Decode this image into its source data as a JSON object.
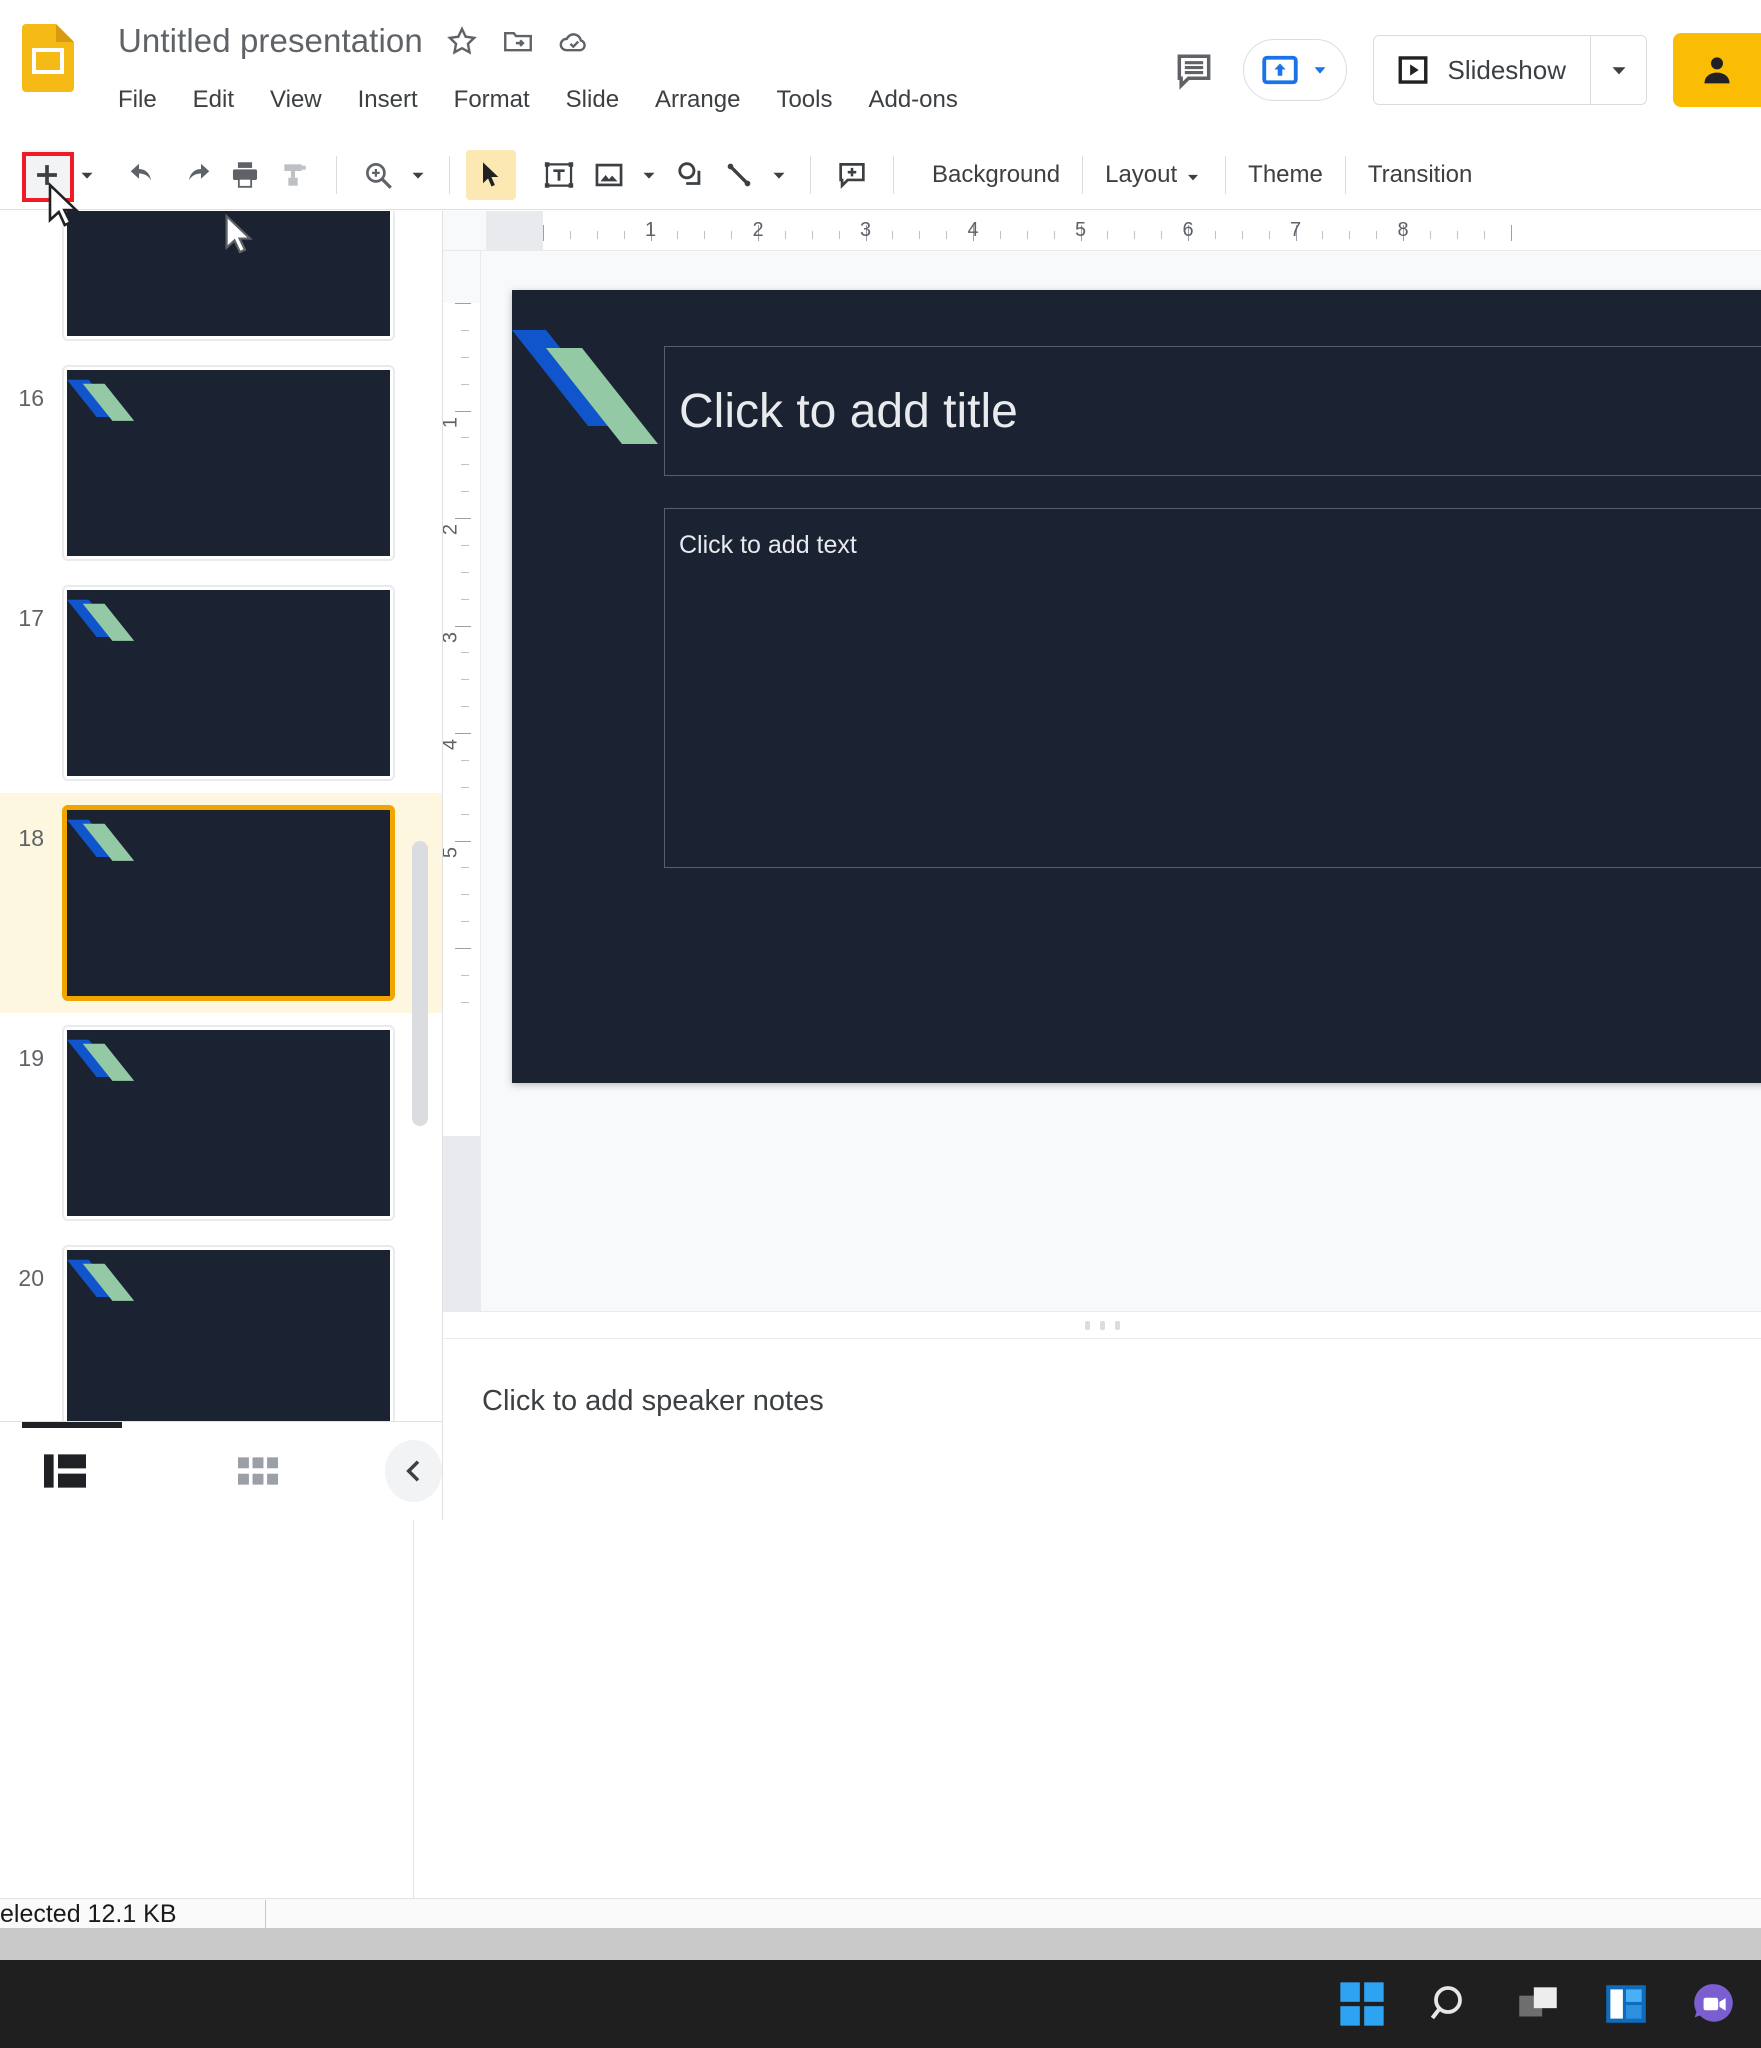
{
  "app": {
    "name": "Google Slides",
    "doc_title": "Untitled presentation"
  },
  "header": {
    "icons": [
      "star-icon",
      "move-to-folder-icon",
      "cloud-saved-icon"
    ],
    "menu_items": [
      "File",
      "Edit",
      "View",
      "Insert",
      "Format",
      "Slide",
      "Arrange",
      "Tools",
      "Add-ons"
    ],
    "comment_icon": "comment-history-icon",
    "present_icon": "present-to-meeting-icon",
    "slideshow_label": "Slideshow",
    "share_icon": "share-person-icon"
  },
  "toolbar": {
    "items": [
      {
        "name": "new-slide-button",
        "icon": "plus-icon",
        "highlighted": true
      },
      {
        "name": "new-slide-dropdown",
        "icon": "chevron-down-icon"
      },
      {
        "name": "undo-button",
        "icon": "undo-icon"
      },
      {
        "name": "redo-button",
        "icon": "redo-icon"
      },
      {
        "name": "print-button",
        "icon": "print-icon"
      },
      {
        "name": "paint-format-button",
        "icon": "paint-roller-icon"
      },
      {
        "name": "zoom-button",
        "icon": "zoom-in-icon"
      },
      {
        "name": "zoom-dropdown",
        "icon": "chevron-down-icon"
      },
      {
        "name": "select-tool",
        "icon": "cursor-arrow-icon",
        "selected": true
      },
      {
        "name": "textbox-tool",
        "icon": "text-box-icon"
      },
      {
        "name": "image-tool",
        "icon": "image-icon"
      },
      {
        "name": "image-dropdown",
        "icon": "chevron-down-icon"
      },
      {
        "name": "shape-tool",
        "icon": "shape-icon"
      },
      {
        "name": "line-tool",
        "icon": "line-icon"
      },
      {
        "name": "line-dropdown",
        "icon": "chevron-down-icon"
      },
      {
        "name": "add-comment-button",
        "icon": "add-comment-icon"
      }
    ],
    "background_label": "Background",
    "layout_label": "Layout",
    "theme_label": "Theme",
    "transition_label": "Transition",
    "highlight_color": "#ee1c25",
    "selected_color": "#fce8b2"
  },
  "filmstrip": {
    "slides": [
      {
        "number": "",
        "selected": false,
        "partial": true
      },
      {
        "number": "16",
        "selected": false
      },
      {
        "number": "17",
        "selected": false
      },
      {
        "number": "18",
        "selected": true
      },
      {
        "number": "19",
        "selected": false
      },
      {
        "number": "20",
        "selected": false
      }
    ],
    "selection_color": "#f0a500",
    "slide_bg": "#1b2333",
    "ribbon_blue": "#1155cc",
    "ribbon_green": "#93c9a5",
    "bottom": {
      "filmstrip_view_icon": "filmstrip-view-icon",
      "grid_view_icon": "grid-view-icon",
      "collapse_icon": "chevron-left-icon"
    }
  },
  "ruler": {
    "horizontal_labels": [
      "1",
      "2",
      "3",
      "4",
      "5",
      "6",
      "7",
      "8"
    ],
    "vertical_labels": [
      "1",
      "2",
      "3",
      "4",
      "5"
    ]
  },
  "canvas": {
    "title_placeholder": "Click to add title",
    "body_placeholder": "Click to add text"
  },
  "notes": {
    "placeholder": "Click to add speaker notes"
  },
  "status": {
    "text": "elected  12.1 KB"
  },
  "taskbar": {
    "items": [
      {
        "name": "start-button",
        "icon": "windows-start-icon"
      },
      {
        "name": "search-button",
        "icon": "search-icon"
      },
      {
        "name": "task-view-button",
        "icon": "task-view-icon"
      },
      {
        "name": "widgets-button",
        "icon": "widgets-icon"
      },
      {
        "name": "chat-button",
        "icon": "chat-video-icon"
      }
    ]
  }
}
